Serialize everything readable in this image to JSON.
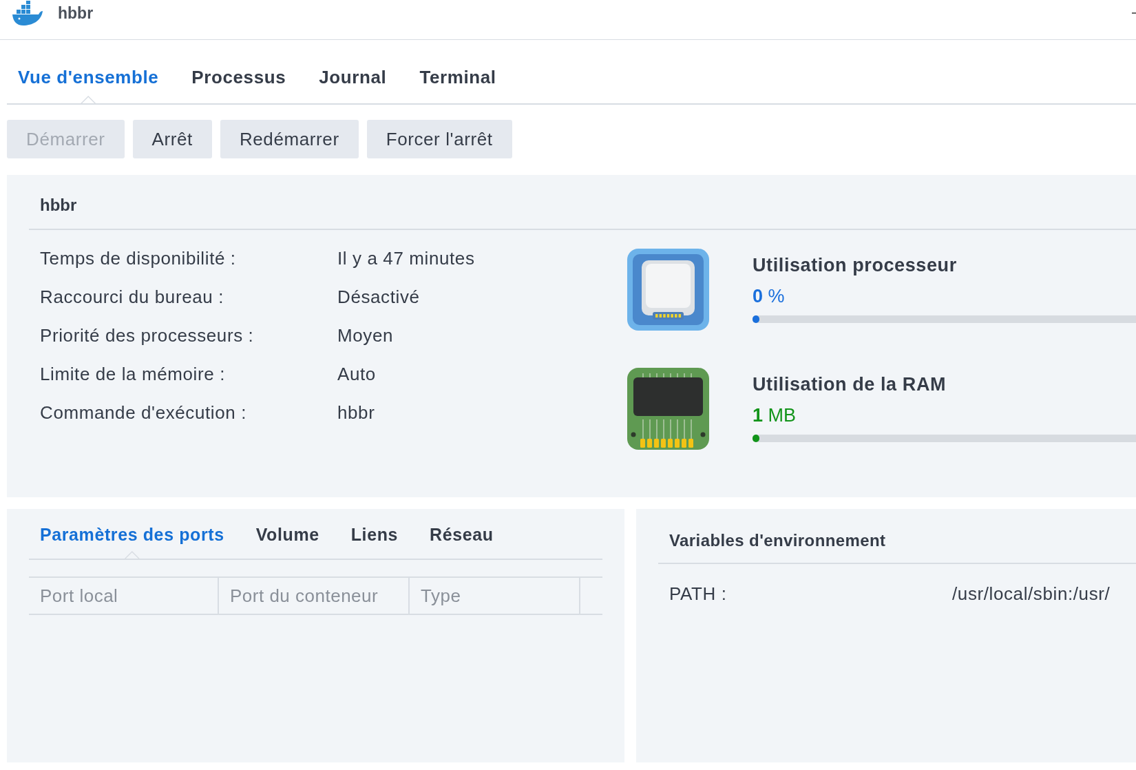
{
  "window": {
    "title": "hbbr"
  },
  "tabs": [
    {
      "label": "Vue d'ensemble",
      "selected": true
    },
    {
      "label": "Processus",
      "selected": false
    },
    {
      "label": "Journal",
      "selected": false
    },
    {
      "label": "Terminal",
      "selected": false
    }
  ],
  "actions": [
    {
      "label": "Démarrer",
      "disabled": true
    },
    {
      "label": "Arrêt",
      "disabled": false
    },
    {
      "label": "Redémarrer",
      "disabled": false
    },
    {
      "label": "Forcer l'arrêt",
      "disabled": false
    }
  ],
  "container": {
    "name": "hbbr",
    "details": [
      {
        "label": "Temps de disponibilité :",
        "value": "Il y a 47 minutes"
      },
      {
        "label": "Raccourci du bureau :",
        "value": "Désactivé"
      },
      {
        "label": "Priorité des processeurs :",
        "value": "Moyen"
      },
      {
        "label": "Limite de la mémoire :",
        "value": "Auto"
      },
      {
        "label": "Commande d'exécution :",
        "value": "hbbr"
      }
    ],
    "metrics": [
      {
        "kind": "cpu",
        "title": "Utilisation processeur",
        "value": "0",
        "unit": "%",
        "level": 0.01,
        "color": "#1a6fdc"
      },
      {
        "kind": "ram",
        "title": "Utilisation de la RAM",
        "value": "1",
        "unit": "MB",
        "level": 0.01,
        "color": "#12941a"
      }
    ]
  },
  "port_settings": {
    "tabs": [
      {
        "label": "Paramètres des ports",
        "selected": true
      },
      {
        "label": "Volume",
        "selected": false
      },
      {
        "label": "Liens",
        "selected": false
      },
      {
        "label": "Réseau",
        "selected": false
      }
    ],
    "columns": [
      "Port local",
      "Port du conteneur",
      "Type"
    ]
  },
  "environment": {
    "title": "Variables d'environnement",
    "variables": [
      {
        "name": "PATH :",
        "value": "/usr/local/sbin:/usr/"
      }
    ]
  }
}
